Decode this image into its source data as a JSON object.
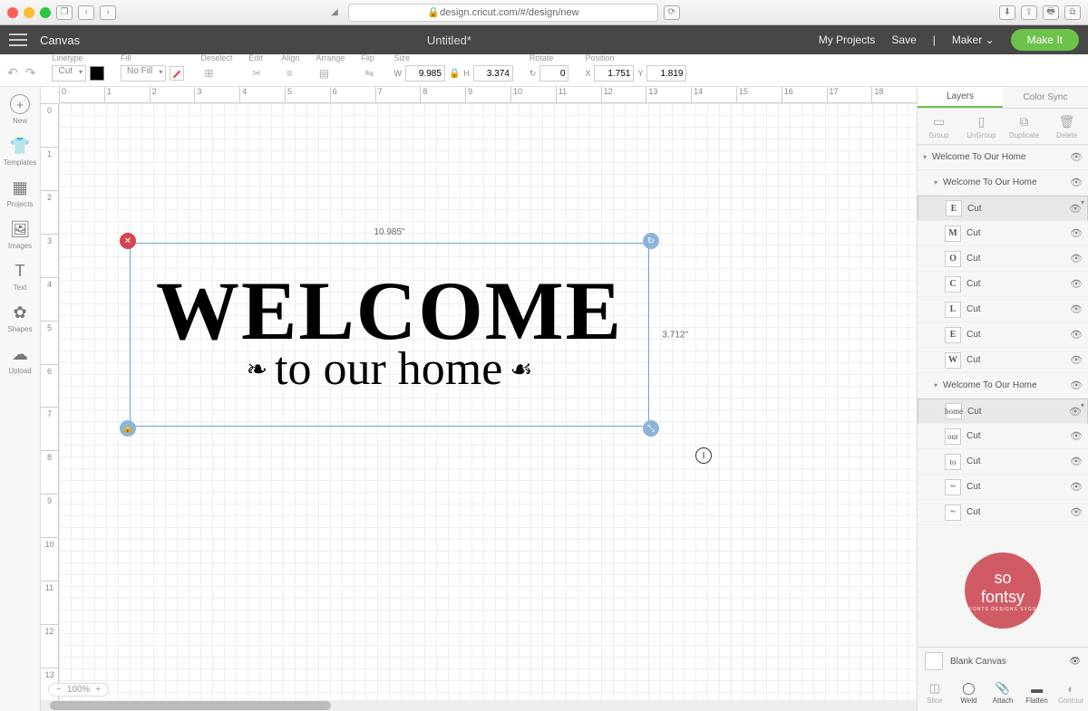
{
  "browser": {
    "url": "design.cricut.com/#/design/new"
  },
  "app": {
    "page": "Canvas",
    "title": "Untitled*",
    "links": {
      "projects": "My Projects",
      "save": "Save",
      "maker": "Maker",
      "makeit": "Make It"
    }
  },
  "toolbar": {
    "linetype": {
      "label": "Linetype",
      "value": "Cut"
    },
    "fill": {
      "label": "Fill",
      "value": "No Fill"
    },
    "deselect": "Deselect",
    "edit": "Edit",
    "align": "Align",
    "arrange": "Arrange",
    "flip": "Flip",
    "size": {
      "label": "Size",
      "w": "9.985",
      "h": "3.374"
    },
    "rotate": {
      "label": "Rotate",
      "value": "0"
    },
    "position": {
      "label": "Position",
      "x": "1.751",
      "y": "1.819"
    }
  },
  "rail": [
    {
      "icon": "+",
      "label": "New"
    },
    {
      "icon": "👕",
      "label": "Templates"
    },
    {
      "icon": "▦",
      "label": "Projects"
    },
    {
      "icon": "🖼",
      "label": "Images"
    },
    {
      "icon": "T",
      "label": "Text"
    },
    {
      "icon": "✿",
      "label": "Shapes"
    },
    {
      "icon": "☁",
      "label": "Upload"
    }
  ],
  "selection": {
    "w": "10.985\"",
    "h": "3.712\"",
    "art1": "WELCOME",
    "art2": "to our home"
  },
  "zoom": "100%",
  "tabs": {
    "layers": "Layers",
    "color": "Color Sync"
  },
  "ract": [
    [
      "▭",
      "Group"
    ],
    [
      "▯",
      "UnGroup"
    ],
    [
      "⧉",
      "Duplicate"
    ],
    [
      "🗑",
      "Delete"
    ]
  ],
  "layers": {
    "top": "Welcome To Our Home",
    "g1": "Welcome To Our Home",
    "letters": [
      [
        "E",
        "Cut"
      ],
      [
        "M",
        "Cut"
      ],
      [
        "O",
        "Cut"
      ],
      [
        "C",
        "Cut"
      ],
      [
        "L",
        "Cut"
      ],
      [
        "E",
        "Cut"
      ],
      [
        "W",
        "Cut"
      ]
    ],
    "g2": "Welcome To Our Home",
    "words": [
      [
        "home",
        "Cut"
      ],
      [
        "our",
        "Cut"
      ],
      [
        "to",
        "Cut"
      ],
      [
        "~",
        "Cut"
      ],
      [
        "~",
        "Cut"
      ]
    ]
  },
  "logo": {
    "t1": "so",
    "t2": "fontsy",
    "t3": "FONTS DESIGNS SVGS"
  },
  "blank": "Blank Canvas",
  "bact": [
    [
      "◫",
      "Slice",
      0
    ],
    [
      "◯",
      "Weld",
      1
    ],
    [
      "📎",
      "Attach",
      1
    ],
    [
      "▬",
      "Flatten",
      1
    ],
    [
      "◐",
      "Contour",
      0
    ]
  ]
}
